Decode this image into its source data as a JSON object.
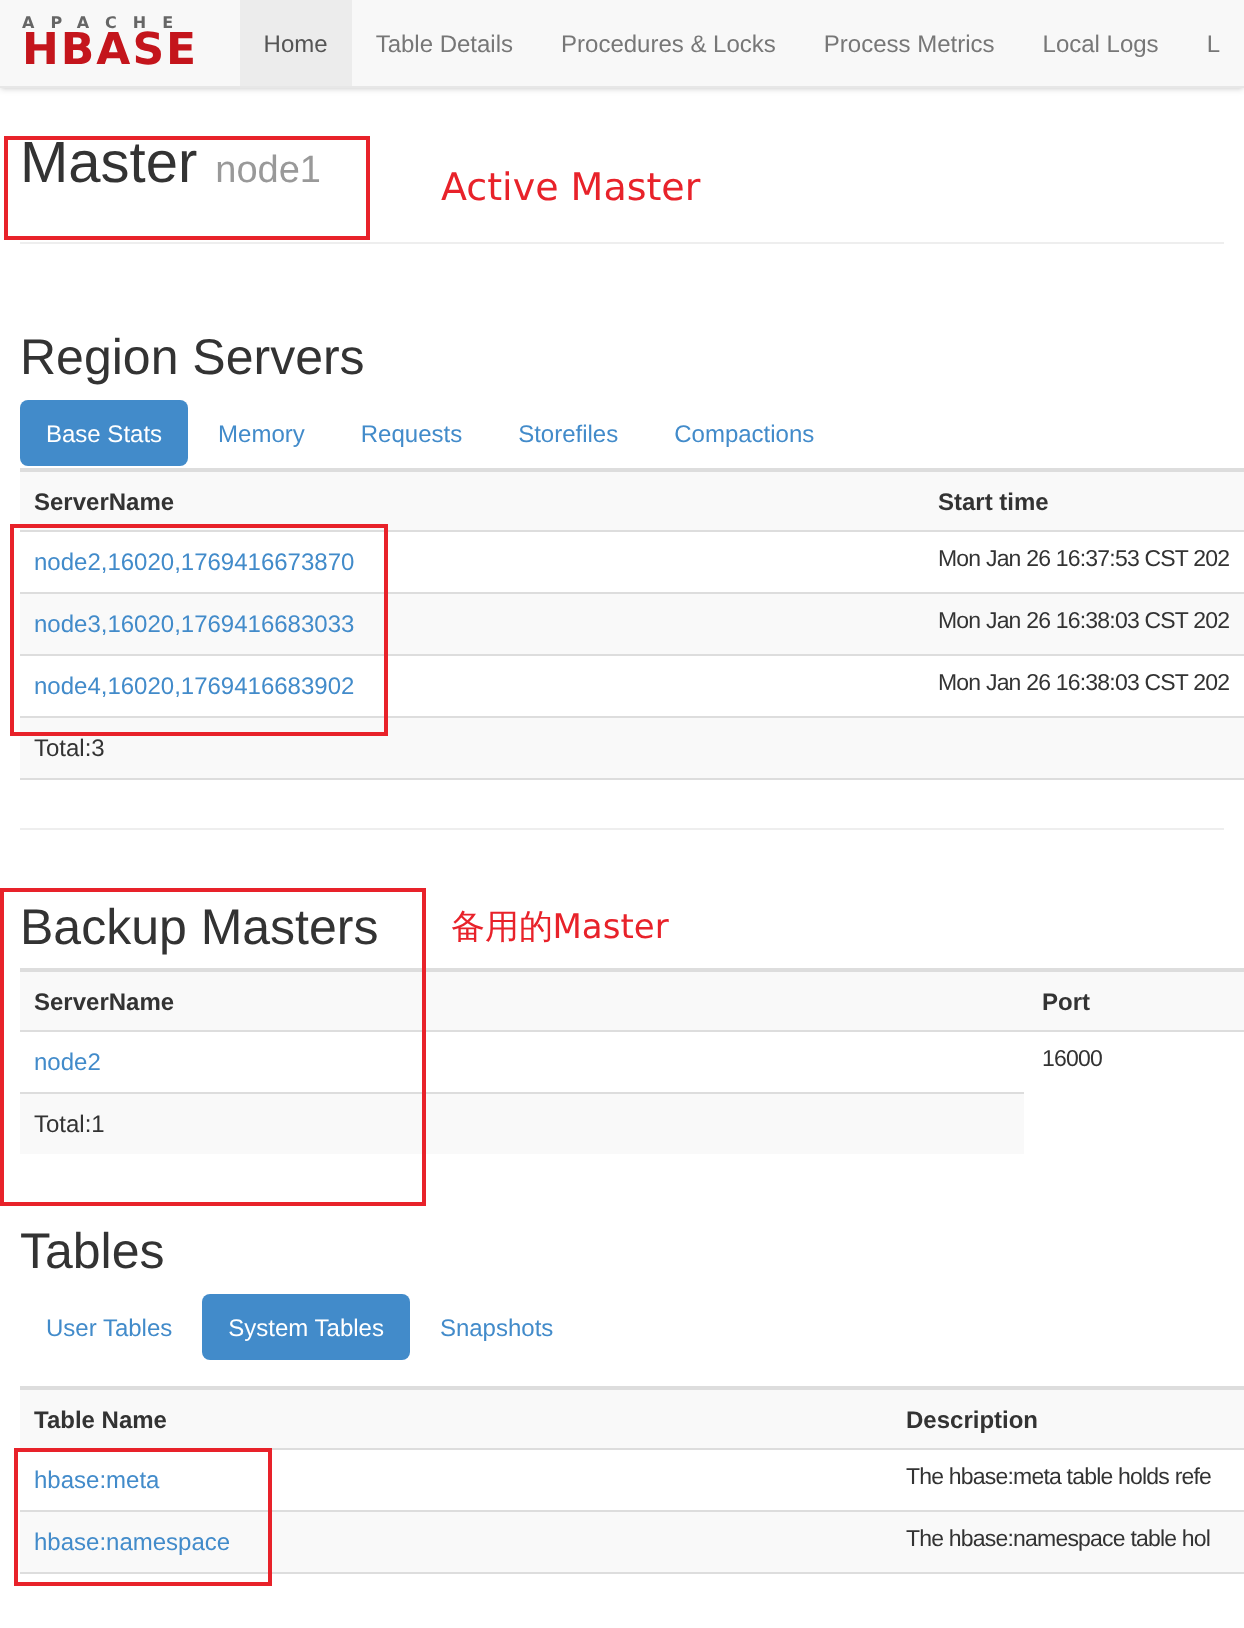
{
  "navbar": {
    "logo": {
      "top": "APACHE",
      "bottom": "HBASE"
    },
    "items": [
      {
        "label": "Home",
        "selected": true
      },
      {
        "label": "Table Details",
        "selected": false
      },
      {
        "label": "Procedures & Locks",
        "selected": false
      },
      {
        "label": "Process Metrics",
        "selected": false
      },
      {
        "label": "Local Logs",
        "selected": false
      },
      {
        "label": "L",
        "selected": false
      }
    ]
  },
  "master": {
    "title": "Master",
    "host": "node1",
    "note": "Active Master"
  },
  "region_servers": {
    "title": "Region Servers",
    "tabs": [
      {
        "label": "Base Stats",
        "selected": true
      },
      {
        "label": "Memory",
        "selected": false
      },
      {
        "label": "Requests",
        "selected": false
      },
      {
        "label": "Storefiles",
        "selected": false
      },
      {
        "label": "Compactions",
        "selected": false
      }
    ],
    "columns": [
      "ServerName",
      "Start time"
    ],
    "rows": [
      [
        "node2,16020,1769416673870",
        "Mon Jan 26 16:37:53 CST 202"
      ],
      [
        "node3,16020,1769416683033",
        "Mon Jan 26 16:38:03 CST 202"
      ],
      [
        "node4,16020,1769416683902",
        "Mon Jan 26 16:38:03 CST 202"
      ]
    ],
    "total": "Total:3"
  },
  "backup_masters": {
    "title": "Backup Masters",
    "note": "备用的Master",
    "columns": [
      "ServerName",
      "Port"
    ],
    "rows": [
      [
        "node2",
        "16000"
      ]
    ],
    "total": "Total:1"
  },
  "tables": {
    "title": "Tables",
    "tabs": [
      {
        "label": "User Tables",
        "selected": false
      },
      {
        "label": "System Tables",
        "selected": true
      },
      {
        "label": "Snapshots",
        "selected": false
      }
    ],
    "columns": [
      "Table Name",
      "Description"
    ],
    "rows": [
      [
        "hbase:meta",
        "The hbase:meta table holds refe"
      ],
      [
        "hbase:namespace",
        "The hbase:namespace table hol"
      ]
    ]
  }
}
